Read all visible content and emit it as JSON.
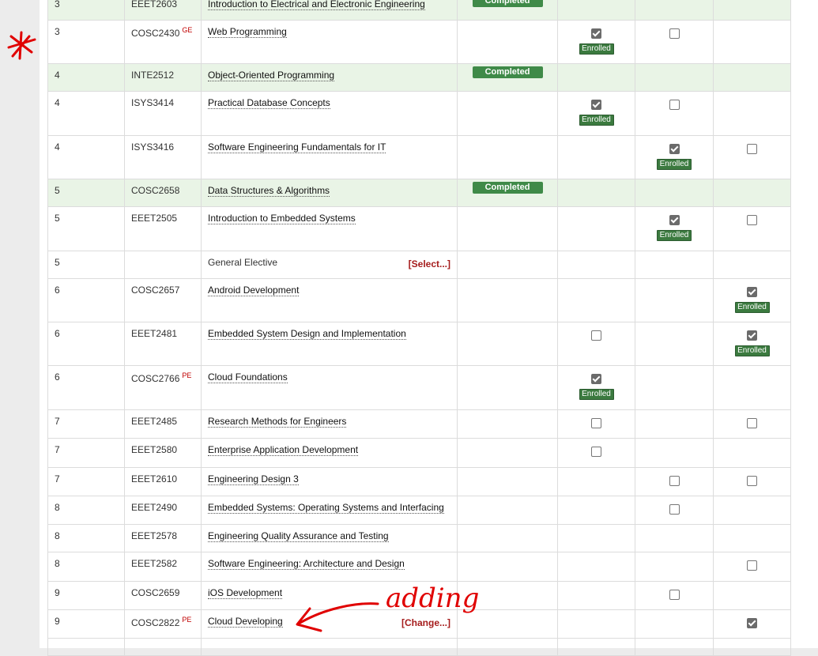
{
  "badges": {
    "completed": "Completed",
    "enrolled": "Enrolled"
  },
  "colors": {
    "completed_row_bg": "#e9f4e6",
    "completed_badge": "#3f8a48",
    "enrolled_badge": "#3b7a3f",
    "action_link": "#a51c1c",
    "annotation": "#e00000"
  },
  "rows": [
    {
      "sem": "3",
      "code": "EEET2603",
      "tag": "",
      "title": "Introduction to Electrical and Electronic Engineering",
      "link": true,
      "action": "",
      "status": "Completed",
      "checks": [
        null,
        null,
        null
      ]
    },
    {
      "sem": "3",
      "code": "COSC2430",
      "tag": "GE",
      "title": "Web Programming",
      "link": true,
      "action": "",
      "status": "",
      "checks": [
        "enrolled",
        "unchecked",
        null
      ]
    },
    {
      "sem": "4",
      "code": "INTE2512",
      "tag": "",
      "title": "Object-Oriented Programming",
      "link": true,
      "action": "",
      "status": "Completed",
      "checks": [
        null,
        null,
        null
      ]
    },
    {
      "sem": "4",
      "code": "ISYS3414",
      "tag": "",
      "title": "Practical Database Concepts",
      "link": true,
      "action": "",
      "status": "",
      "checks": [
        "enrolled",
        "unchecked",
        null
      ]
    },
    {
      "sem": "4",
      "code": "ISYS3416",
      "tag": "",
      "title": "Software Engineering Fundamentals for IT",
      "link": true,
      "action": "",
      "status": "",
      "checks": [
        null,
        "enrolled",
        "unchecked"
      ]
    },
    {
      "sem": "5",
      "code": "COSC2658",
      "tag": "",
      "title": "Data Structures & Algorithms",
      "link": true,
      "action": "",
      "status": "Completed",
      "checks": [
        null,
        null,
        null
      ]
    },
    {
      "sem": "5",
      "code": "EEET2505",
      "tag": "",
      "title": "Introduction to Embedded Systems",
      "link": true,
      "action": "",
      "status": "",
      "checks": [
        null,
        "enrolled",
        "unchecked"
      ]
    },
    {
      "sem": "5",
      "code": "",
      "tag": "",
      "title": "General Elective",
      "link": false,
      "action": "[Select...]",
      "status": "",
      "checks": [
        null,
        null,
        null
      ]
    },
    {
      "sem": "6",
      "code": "COSC2657",
      "tag": "",
      "title": "Android Development",
      "link": true,
      "action": "",
      "status": "",
      "checks": [
        null,
        null,
        "enrolled"
      ]
    },
    {
      "sem": "6",
      "code": "EEET2481",
      "tag": "",
      "title": "Embedded System Design and Implementation",
      "link": true,
      "action": "",
      "status": "",
      "checks": [
        "unchecked",
        null,
        "enrolled"
      ]
    },
    {
      "sem": "6",
      "code": "COSC2766",
      "tag": "PE",
      "title": "Cloud Foundations",
      "link": true,
      "action": "",
      "status": "",
      "checks": [
        "enrolled",
        null,
        null
      ]
    },
    {
      "sem": "7",
      "code": "EEET2485",
      "tag": "",
      "title": "Research Methods for Engineers",
      "link": true,
      "action": "",
      "status": "",
      "checks": [
        "unchecked",
        null,
        "unchecked"
      ]
    },
    {
      "sem": "7",
      "code": "EEET2580",
      "tag": "",
      "title": "Enterprise Application Development",
      "link": true,
      "action": "",
      "status": "",
      "checks": [
        "unchecked",
        null,
        null
      ]
    },
    {
      "sem": "7",
      "code": "EEET2610",
      "tag": "",
      "title": "Engineering Design 3",
      "link": true,
      "action": "",
      "status": "",
      "checks": [
        null,
        "unchecked",
        "unchecked"
      ]
    },
    {
      "sem": "8",
      "code": "EEET2490",
      "tag": "",
      "title": "Embedded Systems: Operating Systems and Interfacing",
      "link": true,
      "action": "",
      "status": "",
      "checks": [
        null,
        "unchecked",
        null
      ]
    },
    {
      "sem": "8",
      "code": "EEET2578",
      "tag": "",
      "title": "Engineering Quality Assurance and Testing",
      "link": true,
      "action": "",
      "status": "",
      "checks": [
        null,
        null,
        null
      ]
    },
    {
      "sem": "8",
      "code": "EEET2582",
      "tag": "",
      "title": "Software Engineering: Architecture and Design",
      "link": true,
      "action": "",
      "status": "",
      "checks": [
        null,
        null,
        "unchecked"
      ]
    },
    {
      "sem": "9",
      "code": "COSC2659",
      "tag": "",
      "title": "iOS Development",
      "link": true,
      "action": "",
      "status": "",
      "checks": [
        null,
        "unchecked",
        null
      ]
    },
    {
      "sem": "9",
      "code": "COSC2822",
      "tag": "PE",
      "title": "Cloud Developing",
      "link": true,
      "action": "[Change...]",
      "status": "",
      "checks": [
        null,
        null,
        "checked"
      ]
    },
    {
      "sem": "",
      "code": "",
      "tag": "",
      "title": "",
      "link": false,
      "action": "",
      "status": "",
      "checks": [
        null,
        null,
        null
      ]
    }
  ],
  "annotation": {
    "text": "adding"
  }
}
